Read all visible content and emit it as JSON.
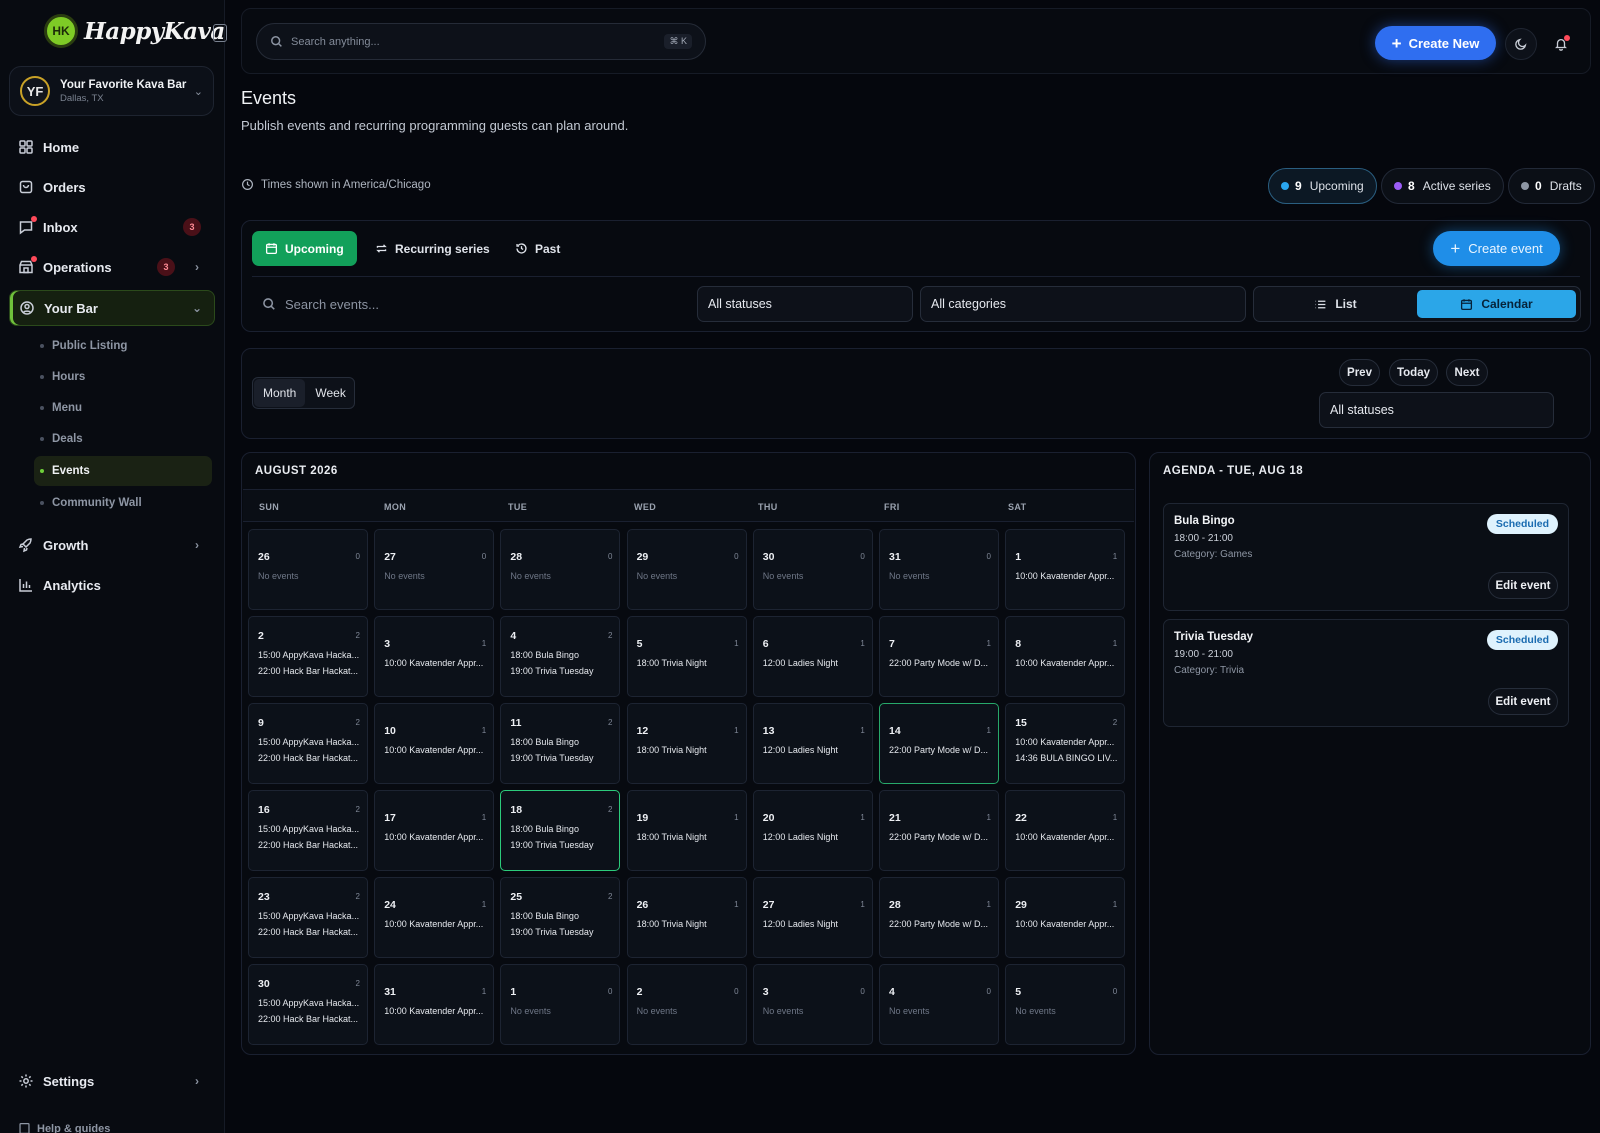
{
  "brand": {
    "logo_text": "HappyKava",
    "mark": "HK"
  },
  "org": {
    "initials": "YF",
    "name": "Your Favorite Kava Bar",
    "location": "Dallas, TX"
  },
  "nav": {
    "home": "Home",
    "orders": "Orders",
    "inbox": {
      "label": "Inbox",
      "badge": "3"
    },
    "operations": {
      "label": "Operations",
      "badge": "3"
    },
    "your_bar": "Your Bar",
    "sub_items": [
      "Public Listing",
      "Hours",
      "Menu",
      "Deals",
      "Events",
      "Community Wall"
    ],
    "active_sub": "Events",
    "growth": "Growth",
    "analytics": "Analytics",
    "settings": "Settings",
    "help": "Help & guides"
  },
  "topbar": {
    "search_placeholder": "Search anything...",
    "shortcut": "⌘ K",
    "create_new": "Create New"
  },
  "page": {
    "title": "Events",
    "subtitle": "Publish events and recurring programming guests can plan around.",
    "timezone_note": "Times shown in America/Chicago"
  },
  "stats": [
    {
      "count": "9",
      "label": "Upcoming",
      "color": "#2aa6f0"
    },
    {
      "count": "8",
      "label": "Active series",
      "color": "#9b5cf6"
    },
    {
      "count": "0",
      "label": "Drafts",
      "color": "#8e96a4"
    }
  ],
  "tabs": {
    "upcoming": "Upcoming",
    "recurring": "Recurring series",
    "past": "Past",
    "create_event": "Create event"
  },
  "filters": {
    "search_placeholder": "Search events...",
    "status": "All statuses",
    "category": "All categories",
    "list": "List",
    "calendar": "Calendar"
  },
  "calendar_controls": {
    "month": "Month",
    "week": "Week",
    "prev": "Prev",
    "today": "Today",
    "next": "Next",
    "status": "All statuses"
  },
  "calendar": {
    "title": "AUGUST 2026",
    "weekdays": [
      "SUN",
      "MON",
      "TUE",
      "WED",
      "THU",
      "FRI",
      "SAT"
    ],
    "no_events": "No events",
    "weeks": [
      [
        {
          "d": "26",
          "n": "0",
          "e": []
        },
        {
          "d": "27",
          "n": "0",
          "e": []
        },
        {
          "d": "28",
          "n": "0",
          "e": []
        },
        {
          "d": "29",
          "n": "0",
          "e": []
        },
        {
          "d": "30",
          "n": "0",
          "e": []
        },
        {
          "d": "31",
          "n": "0",
          "e": []
        },
        {
          "d": "1",
          "n": "1",
          "e": [
            "10:00 Kavatender Appr..."
          ]
        }
      ],
      [
        {
          "d": "2",
          "n": "2",
          "e": [
            "15:00 AppyKava Hacka...",
            "22:00 Hack Bar Hackat..."
          ]
        },
        {
          "d": "3",
          "n": "1",
          "e": [
            "10:00 Kavatender Appr..."
          ]
        },
        {
          "d": "4",
          "n": "2",
          "e": [
            "18:00 Bula Bingo",
            "19:00 Trivia Tuesday"
          ]
        },
        {
          "d": "5",
          "n": "1",
          "e": [
            "18:00 Trivia Night"
          ]
        },
        {
          "d": "6",
          "n": "1",
          "e": [
            "12:00 Ladies Night"
          ]
        },
        {
          "d": "7",
          "n": "1",
          "e": [
            "22:00 Party Mode w/ D..."
          ]
        },
        {
          "d": "8",
          "n": "1",
          "e": [
            "10:00 Kavatender Appr..."
          ]
        }
      ],
      [
        {
          "d": "9",
          "n": "2",
          "e": [
            "15:00 AppyKava Hacka...",
            "22:00 Hack Bar Hackat..."
          ]
        },
        {
          "d": "10",
          "n": "1",
          "e": [
            "10:00 Kavatender Appr..."
          ]
        },
        {
          "d": "11",
          "n": "2",
          "e": [
            "18:00 Bula Bingo",
            "19:00 Trivia Tuesday"
          ]
        },
        {
          "d": "12",
          "n": "1",
          "e": [
            "18:00 Trivia Night"
          ]
        },
        {
          "d": "13",
          "n": "1",
          "e": [
            "12:00 Ladies Night"
          ]
        },
        {
          "d": "14",
          "n": "1",
          "e": [
            "22:00 Party Mode w/ D..."
          ]
        },
        {
          "d": "15",
          "n": "2",
          "e": [
            "10:00 Kavatender Appr...",
            "14:36 BULA BINGO LIV..."
          ]
        }
      ],
      [
        {
          "d": "16",
          "n": "2",
          "e": [
            "15:00 AppyKava Hacka...",
            "22:00 Hack Bar Hackat..."
          ]
        },
        {
          "d": "17",
          "n": "1",
          "e": [
            "10:00 Kavatender Appr..."
          ]
        },
        {
          "d": "18",
          "n": "2",
          "e": [
            "18:00 Bula Bingo",
            "19:00 Trivia Tuesday"
          ]
        },
        {
          "d": "19",
          "n": "1",
          "e": [
            "18:00 Trivia Night"
          ]
        },
        {
          "d": "20",
          "n": "1",
          "e": [
            "12:00 Ladies Night"
          ]
        },
        {
          "d": "21",
          "n": "1",
          "e": [
            "22:00 Party Mode w/ D..."
          ]
        },
        {
          "d": "22",
          "n": "1",
          "e": [
            "10:00 Kavatender Appr..."
          ]
        }
      ],
      [
        {
          "d": "23",
          "n": "2",
          "e": [
            "15:00 AppyKava Hacka...",
            "22:00 Hack Bar Hackat..."
          ]
        },
        {
          "d": "24",
          "n": "1",
          "e": [
            "10:00 Kavatender Appr..."
          ]
        },
        {
          "d": "25",
          "n": "2",
          "e": [
            "18:00 Bula Bingo",
            "19:00 Trivia Tuesday"
          ]
        },
        {
          "d": "26",
          "n": "1",
          "e": [
            "18:00 Trivia Night"
          ]
        },
        {
          "d": "27",
          "n": "1",
          "e": [
            "12:00 Ladies Night"
          ]
        },
        {
          "d": "28",
          "n": "1",
          "e": [
            "22:00 Party Mode w/ D..."
          ]
        },
        {
          "d": "29",
          "n": "1",
          "e": [
            "10:00 Kavatender Appr..."
          ]
        }
      ],
      [
        {
          "d": "30",
          "n": "2",
          "e": [
            "15:00 AppyKava Hacka...",
            "22:00 Hack Bar Hackat..."
          ]
        },
        {
          "d": "31",
          "n": "1",
          "e": [
            "10:00 Kavatender Appr..."
          ]
        },
        {
          "d": "1",
          "n": "0",
          "e": []
        },
        {
          "d": "2",
          "n": "0",
          "e": []
        },
        {
          "d": "3",
          "n": "0",
          "e": []
        },
        {
          "d": "4",
          "n": "0",
          "e": []
        },
        {
          "d": "5",
          "n": "0",
          "e": []
        }
      ]
    ]
  },
  "agenda": {
    "title": "AGENDA - TUE, AUG 18",
    "items": [
      {
        "name": "Bula Bingo",
        "time": "18:00 - 21:00",
        "category": "Category: Games",
        "status": "Scheduled",
        "edit": "Edit event"
      },
      {
        "name": "Trivia Tuesday",
        "time": "19:00 - 21:00",
        "category": "Category: Trivia",
        "status": "Scheduled",
        "edit": "Edit event"
      }
    ]
  }
}
